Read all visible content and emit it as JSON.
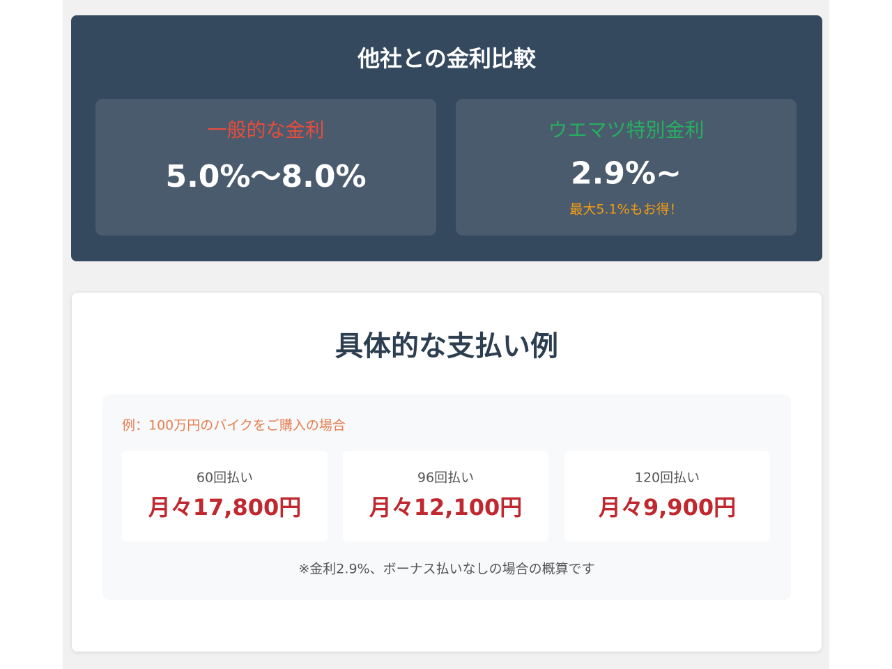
{
  "colors": {
    "page_background": "#f1f1f1",
    "compare_panel": "#34495e",
    "rate_card": "#4a5b6d",
    "general_rate_label": "#e74c3c",
    "special_rate_label": "#27ae60",
    "savings_note": "#f39c12",
    "example_caption": "#e67e50",
    "plan_amount": "#c0282f"
  },
  "comparison": {
    "title": "他社との金利比較",
    "general": {
      "label": "一般的な金利",
      "value": "5.0%〜8.0%"
    },
    "special": {
      "label": "ウエマツ特別金利",
      "value": "2.9%~",
      "note": "最大5.1%もお得！"
    }
  },
  "payment_example": {
    "title": "具体的な支払い例",
    "caption": "例：100万円のバイクをご購入の場合",
    "plans": [
      {
        "label": "60回払い",
        "amount": "月々17,800円"
      },
      {
        "label": "96回払い",
        "amount": "月々12,100円"
      },
      {
        "label": "120回払い",
        "amount": "月々9,900円"
      }
    ],
    "footnote": "※金利2.9%、ボーナス払いなしの場合の概算です"
  }
}
